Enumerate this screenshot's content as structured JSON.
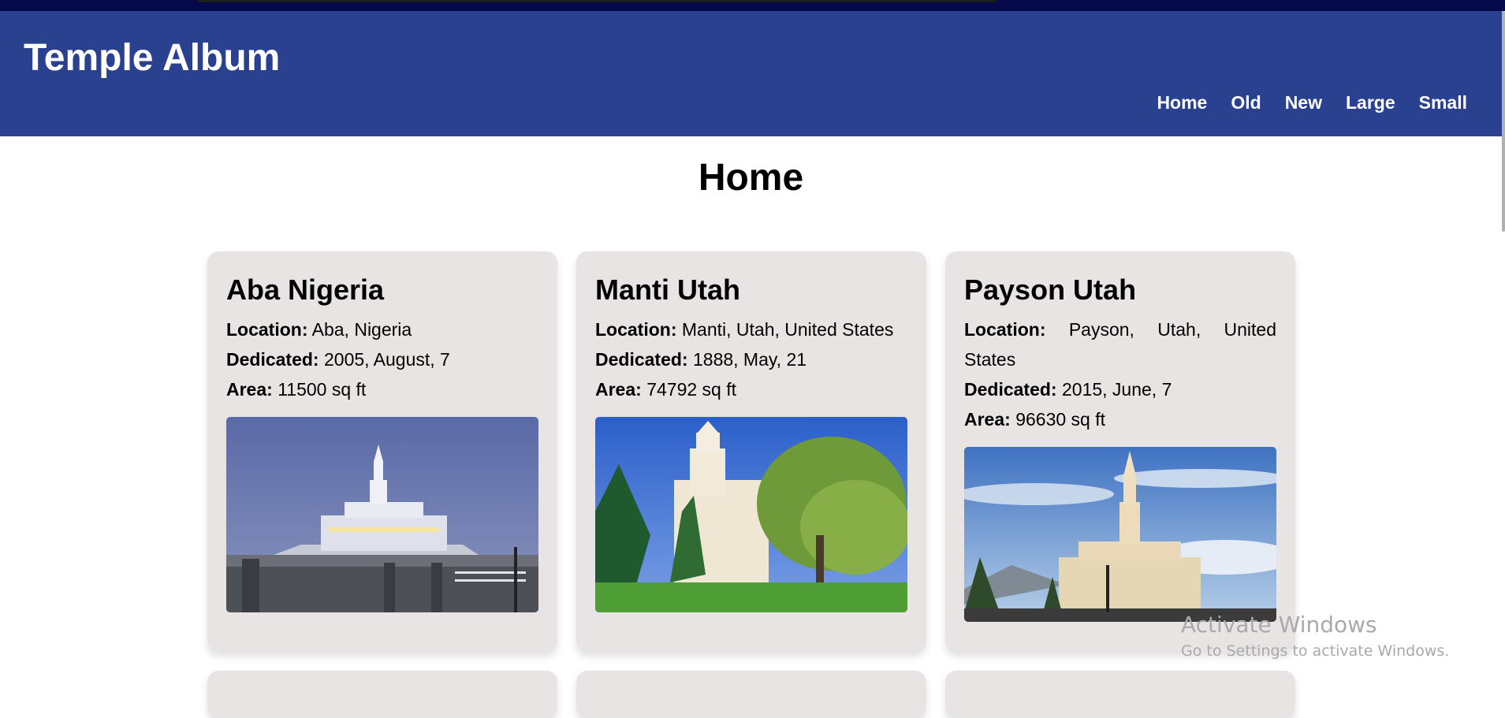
{
  "header": {
    "title": "Temple Album",
    "nav": [
      "Home",
      "Old",
      "New",
      "Large",
      "Small"
    ]
  },
  "page_title": "Home",
  "labels": {
    "location": "Location:",
    "dedicated": "Dedicated:",
    "area": "Area:"
  },
  "temples": [
    {
      "name": "Aba Nigeria",
      "location": "Aba, Nigeria",
      "dedicated": "2005, August, 7",
      "area": "11500 sq ft"
    },
    {
      "name": "Manti Utah",
      "location": "Manti, Utah, United States",
      "dedicated": "1888, May, 21",
      "area": "74792 sq ft"
    },
    {
      "name": "Payson Utah",
      "location": "Payson, Utah, United States",
      "dedicated": "2015, June, 7",
      "area": "96630 sq ft"
    }
  ],
  "watermark": {
    "title": "Activate Windows",
    "subtitle": "Go to Settings to activate Windows."
  },
  "colors": {
    "header_bg": "#2a4190",
    "card_bg": "#e8e4e4"
  }
}
